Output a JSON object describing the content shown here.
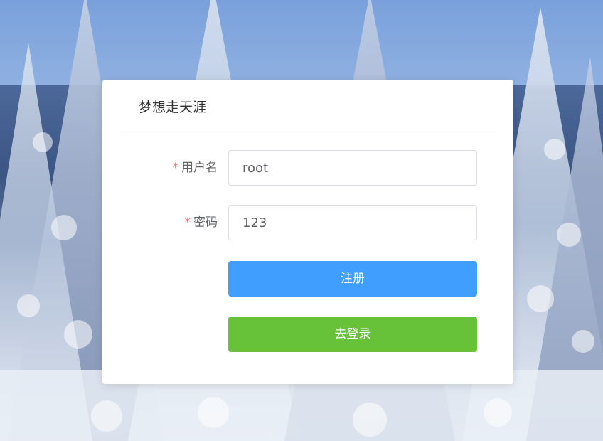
{
  "card": {
    "title": "梦想走天涯"
  },
  "form": {
    "username": {
      "required_mark": "*",
      "label": "用户名",
      "value": "root"
    },
    "password": {
      "required_mark": "*",
      "label": "密码",
      "value": "123"
    }
  },
  "buttons": {
    "register_label": "注册",
    "login_label": "去登录"
  },
  "colors": {
    "primary": "#409eff",
    "success": "#67c23a",
    "required": "#f56c6c"
  }
}
